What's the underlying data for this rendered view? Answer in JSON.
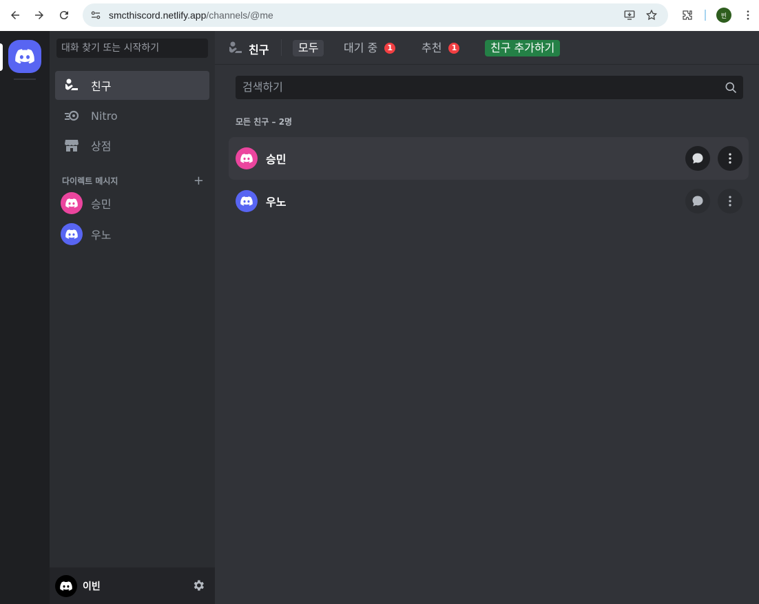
{
  "browser": {
    "url_host": "smcthiscord.netlify.app",
    "url_path": "/channels/@me",
    "profile_initial": "빈"
  },
  "sidebar": {
    "search_placeholder": "대화 찾기 또는 시작하기",
    "nav": [
      {
        "label": "친구",
        "icon": "friends-icon",
        "active": true
      },
      {
        "label": "Nitro",
        "icon": "nitro-icon"
      },
      {
        "label": "상점",
        "icon": "shop-icon"
      }
    ],
    "dm_header": "다이렉트 메시지",
    "dm_add": "+",
    "dms": [
      {
        "name": "승민",
        "color": "#eb459e"
      },
      {
        "name": "우노",
        "color": "#5865f2"
      }
    ],
    "user": {
      "name": "이빈"
    }
  },
  "main": {
    "title": "친구",
    "tabs": [
      {
        "label": "모두"
      },
      {
        "label": "대기 중",
        "badge": "1"
      },
      {
        "label": "추천",
        "badge": "1"
      },
      {
        "label": "친구 추가하기"
      }
    ],
    "search_placeholder": "검색하기",
    "count_label": "모든 친구 – 2명",
    "friends": [
      {
        "name": "승민",
        "color": "#eb459e"
      },
      {
        "name": "우노",
        "color": "#5865f2"
      }
    ]
  },
  "colors": {
    "brand": "#5865f2",
    "add_friend": "#248046",
    "badge": "#f23f42"
  }
}
